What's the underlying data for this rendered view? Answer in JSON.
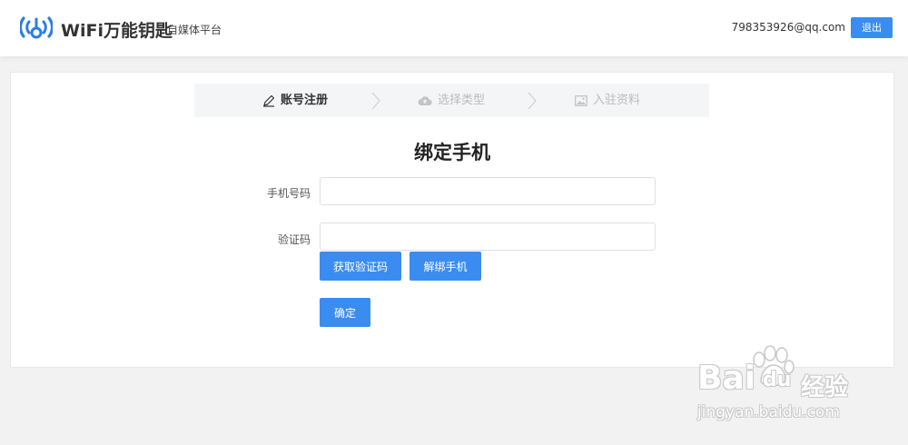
{
  "header": {
    "brand": "WiFi万能钥匙",
    "subtitle": "自媒体平台",
    "user_email": "798353926@qq.com",
    "logout_label": "退出"
  },
  "steps": [
    {
      "label": "账号注册",
      "icon": "pencil-icon",
      "state": "active"
    },
    {
      "label": "选择类型",
      "icon": "cloud-icon",
      "state": "inactive"
    },
    {
      "label": "入驻资料",
      "icon": "image-icon",
      "state": "inactive"
    }
  ],
  "form": {
    "title": "绑定手机",
    "phone_label": "手机号码",
    "phone_value": "",
    "code_label": "验证码",
    "code_value": "",
    "get_code_button": "获取验证码",
    "unbind_button": "解绑手机",
    "confirm_button": "确定"
  },
  "watermark": {
    "logo_text_left": "Bai",
    "logo_text_right": "du",
    "logo_suffix": "经验",
    "url": "jingyan.baidu.com"
  },
  "colors": {
    "accent": "#3b8cf0",
    "brand": "#2a7ee6",
    "background": "#f2f2f2"
  }
}
